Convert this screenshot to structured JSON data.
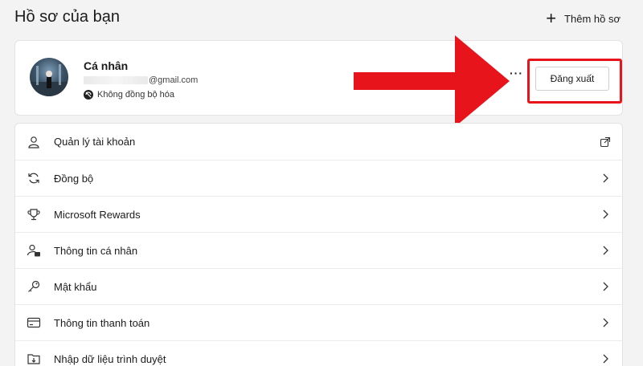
{
  "header": {
    "title": "Hồ sơ của bạn",
    "add_profile_label": "Thêm hồ sơ"
  },
  "profile": {
    "name": "Cá nhân",
    "email_suffix": "@gmail.com",
    "sync_status": "Không đồng bộ hóa",
    "more_label": "···",
    "signout_label": "Đăng xuất"
  },
  "menu": {
    "items": [
      {
        "label": "Quản lý tài khoản",
        "icon": "person-icon",
        "trail": "external-link-icon"
      },
      {
        "label": "Đồng bộ",
        "icon": "sync-icon",
        "trail": "chevron-right-icon"
      },
      {
        "label": "Microsoft Rewards",
        "icon": "trophy-icon",
        "trail": "chevron-right-icon"
      },
      {
        "label": "Thông tin cá nhân",
        "icon": "person-card-icon",
        "trail": "chevron-right-icon"
      },
      {
        "label": "Mật khẩu",
        "icon": "key-icon",
        "trail": "chevron-right-icon"
      },
      {
        "label": "Thông tin thanh toán",
        "icon": "credit-card-icon",
        "trail": "chevron-right-icon"
      },
      {
        "label": "Nhập dữ liệu trình duyệt",
        "icon": "import-icon",
        "trail": "chevron-right-icon"
      }
    ]
  },
  "colors": {
    "highlight": "#e8141c",
    "background": "#f3f3f3"
  }
}
